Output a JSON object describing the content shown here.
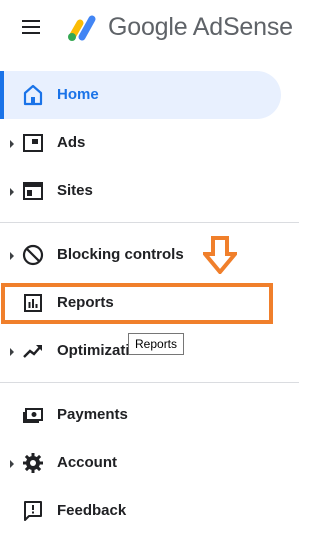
{
  "header": {
    "brand": "Google AdSense",
    "menu_icon": "hamburger-menu-icon",
    "logo_icon": "adsense-logo-icon"
  },
  "nav": {
    "home": {
      "label": "Home",
      "icon": "home-icon",
      "active": true,
      "accent": "#1a73e8"
    },
    "ads": {
      "label": "Ads",
      "icon": "ads-icon"
    },
    "sites": {
      "label": "Sites",
      "icon": "sites-icon"
    },
    "blocking": {
      "label": "Blocking controls",
      "icon": "blocking-icon"
    },
    "reports": {
      "label": "Reports",
      "icon": "reports-icon"
    },
    "optimization": {
      "label": "Optimization",
      "icon": "optimization-icon"
    },
    "payments": {
      "label": "Payments",
      "icon": "payments-icon"
    },
    "account": {
      "label": "Account",
      "icon": "gear-icon"
    },
    "feedback": {
      "label": "Feedback",
      "icon": "feedback-icon"
    }
  },
  "annotation": {
    "highlight_color": "#f07f2b",
    "arrow_icon": "down-arrow-icon"
  },
  "tooltip": {
    "text": "Reports"
  }
}
